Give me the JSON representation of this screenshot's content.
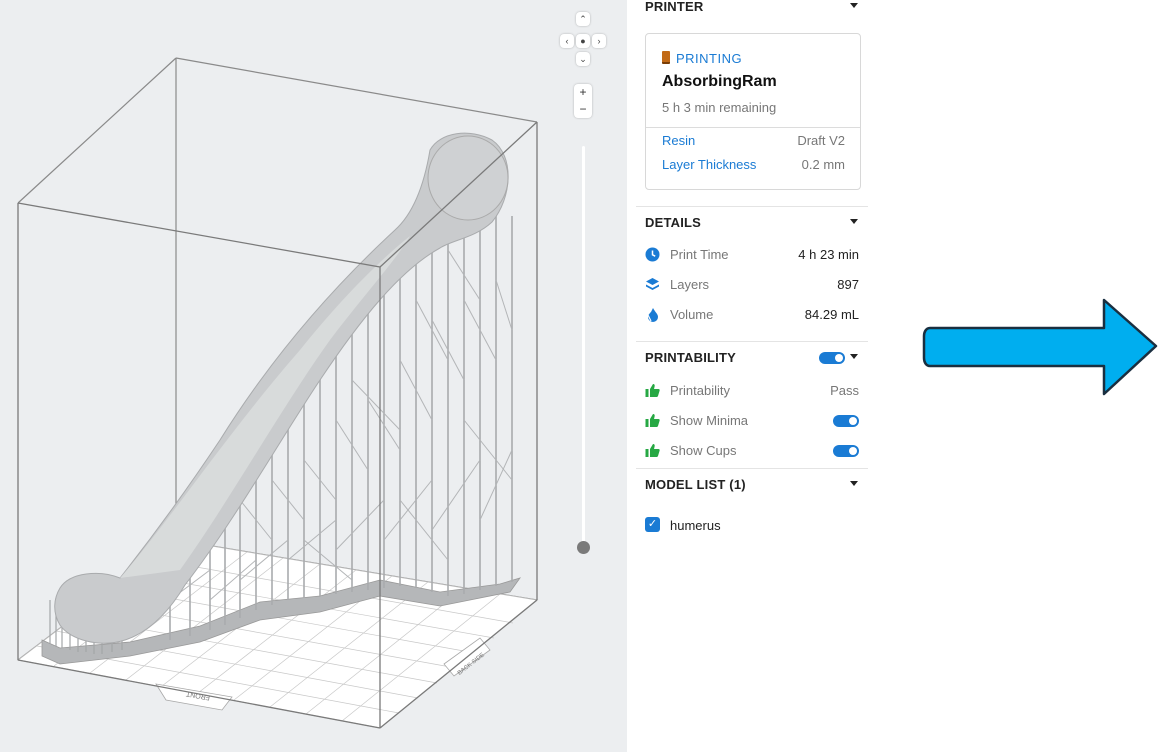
{
  "printer": {
    "section_title": "PRINTER",
    "status": "PRINTING",
    "name": "AbsorbingRam",
    "remaining": "5 h 3 min remaining",
    "resin_label": "Resin",
    "resin_value": "Draft V2",
    "layer_label": "Layer Thickness",
    "layer_value": "0.2 mm"
  },
  "details": {
    "section_title": "DETAILS",
    "rows": [
      {
        "label": "Print Time",
        "value": "4 h 23 min",
        "icon": "clock-icon"
      },
      {
        "label": "Layers",
        "value": "897",
        "icon": "layers-icon"
      },
      {
        "label": "Volume",
        "value": "84.29 mL",
        "icon": "volume-icon"
      }
    ]
  },
  "printability": {
    "section_title": "PRINTABILITY",
    "toggle_on": true,
    "rows": [
      {
        "label": "Printability",
        "value": "Pass",
        "icon": "thumbs-up-icon"
      },
      {
        "label": "Show Minima",
        "toggle_on": true,
        "icon": "thumbs-up-icon"
      },
      {
        "label": "Show Cups",
        "toggle_on": true,
        "icon": "thumbs-up-icon"
      }
    ]
  },
  "model_list": {
    "section_title": "MODEL LIST (1)",
    "items": [
      {
        "name": "humerus",
        "checked": true
      }
    ]
  },
  "viewport": {
    "zoom_in": "+",
    "zoom_out": "−",
    "build_plate_front": "FRONT",
    "build_plate_side": "BACK SIDE",
    "layer_slider_fraction": 1.0
  },
  "colors": {
    "accent": "#1a7bd4",
    "success": "#27a844",
    "arrow": "#00aeef",
    "model_gray": "#c9cbcd"
  }
}
